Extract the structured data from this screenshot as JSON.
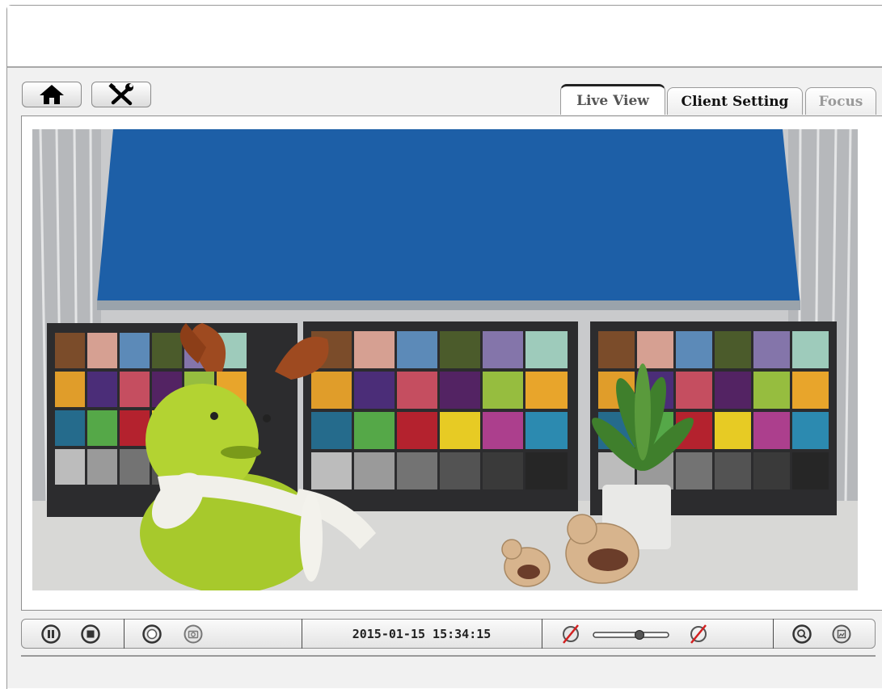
{
  "toolbar": {
    "home_icon": "home-icon",
    "settings_icon": "wrench-screwdriver-icon"
  },
  "tabs": [
    {
      "label": "Live View",
      "active": true
    },
    {
      "label": "Client Setting",
      "active": false
    },
    {
      "label": "Focus",
      "active": false
    }
  ],
  "video": {
    "description_icon": "live-camera-feed"
  },
  "controls": {
    "timestamp": "2015-01-15 15:34:15",
    "buttons": [
      "pause-icon",
      "stop-icon",
      "record-icon",
      "snapshot-icon",
      "mute-icon",
      "volume-slider",
      "mute-icon",
      "zoom-icon",
      "fullscreen-icon"
    ]
  },
  "colors": {
    "accent_red": "#d21f1f",
    "panel_bg": "#f1f1f1",
    "tab_active_border": "#222222"
  }
}
